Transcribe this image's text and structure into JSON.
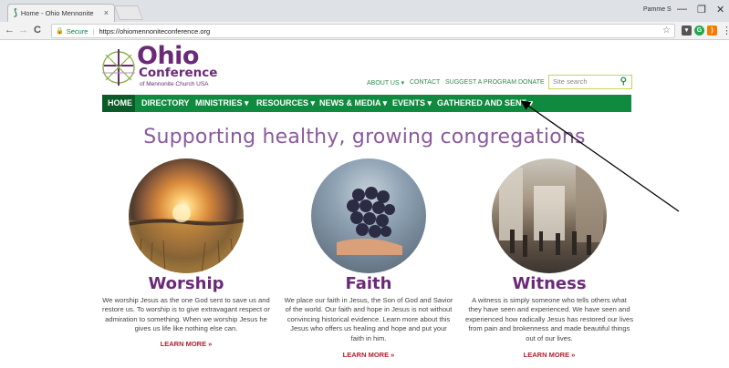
{
  "browser": {
    "tab_title": "Home - Ohio Mennonite",
    "tab_close": "×",
    "user": "Pamme S",
    "minimize": "—",
    "restore": "❐",
    "close": "✕",
    "back": "←",
    "forward": "→",
    "reload": "C",
    "secure_label": "Secure",
    "separator": "|",
    "url": "https://ohiomennoniteconference.org",
    "bookmark": "☆"
  },
  "logo": {
    "line1": "Ohio",
    "line2": "Conference",
    "line3": "of Mennonite Church USA"
  },
  "top_nav": {
    "about": "ABOUT US ▾",
    "contact": "CONTACT",
    "suggest": "SUGGEST A PROGRAM",
    "donate": "DONATE",
    "search_placeholder": "Site search",
    "search_icon": "⚲"
  },
  "main_nav": {
    "home": "HOME",
    "directory": "DIRECTORY",
    "ministries": "MINISTRIES ▾",
    "resources": "RESOURCES ▾",
    "news": "NEWS & MEDIA ▾",
    "events": "EVENTS ▾",
    "gathered": "GATHERED AND SENT ▾"
  },
  "hero": "Supporting healthy, growing congregations",
  "columns": [
    {
      "title": "Worship",
      "lines": [
        "We worship Jesus as the one God sent to save us and",
        "restore us. To worship is to give extravagant respect or",
        "admiration to something. When we worship Jesus he",
        "gives us life like nothing else can."
      ],
      "more": "LEARN MORE »"
    },
    {
      "title": "Faith",
      "lines": [
        "We place our faith in Jesus, the Son of God and Savior",
        "of the world. Our faith and hope in Jesus is not without",
        "convincing historical evidence. Learn more about this",
        "Jesus who offers us healing and hope and put your",
        "faith in him."
      ],
      "more": "LEARN MORE »"
    },
    {
      "title": "Witness",
      "lines": [
        "A witness is simply someone who tells others what",
        "they have seen and experienced. We have seen and",
        "experienced how radically Jesus has restored our lives",
        "from pain and brokenness and made beautiful things",
        "out of our lives."
      ],
      "more": "LEARN MORE »"
    }
  ],
  "colors": {
    "brand_purple": "#6b2a78",
    "nav_green": "#108a3f",
    "nav_active": "#0a5b28",
    "link_red": "#b3202f"
  }
}
